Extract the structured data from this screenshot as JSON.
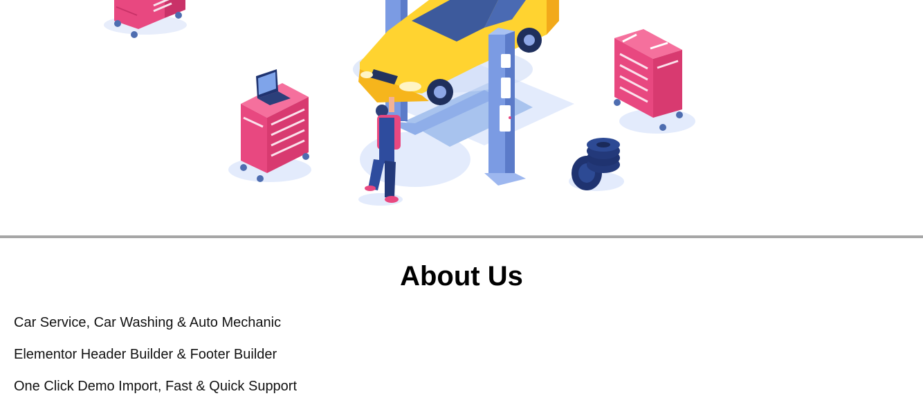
{
  "hero": {
    "illustration": "isometric-car-service-illustration",
    "colors": {
      "car_body": "#ffd330",
      "lift": "#7b9be3",
      "tool_cabinet": "#e84880",
      "tires": "#1f3370",
      "floor_shadow": "#dbe5fb"
    }
  },
  "about": {
    "title": "About Us",
    "features": [
      "Car Service, Car Washing & Auto Mechanic",
      "Elementor Header Builder & Footer Builder",
      "One Click Demo Import, Fast & Quick Support"
    ]
  }
}
